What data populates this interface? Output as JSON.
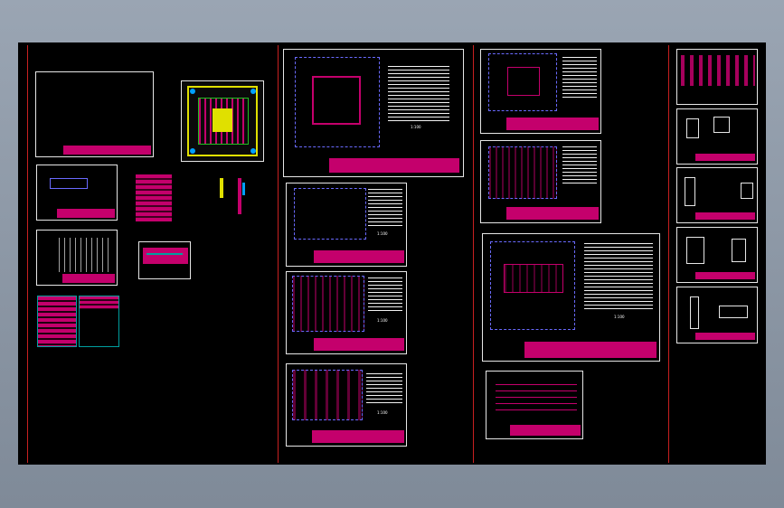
{
  "viewport": {
    "background": "#000000"
  },
  "colors": {
    "frame": "#e6e6e6",
    "title_block": "#c4006c",
    "divider": "#c82020",
    "plan_lines": "#6a6aff",
    "accent_cyan": "#00a0a0",
    "accent_yellow": "#e0e000",
    "accent_green": "#20c020"
  },
  "sheet_label": "1:100"
}
